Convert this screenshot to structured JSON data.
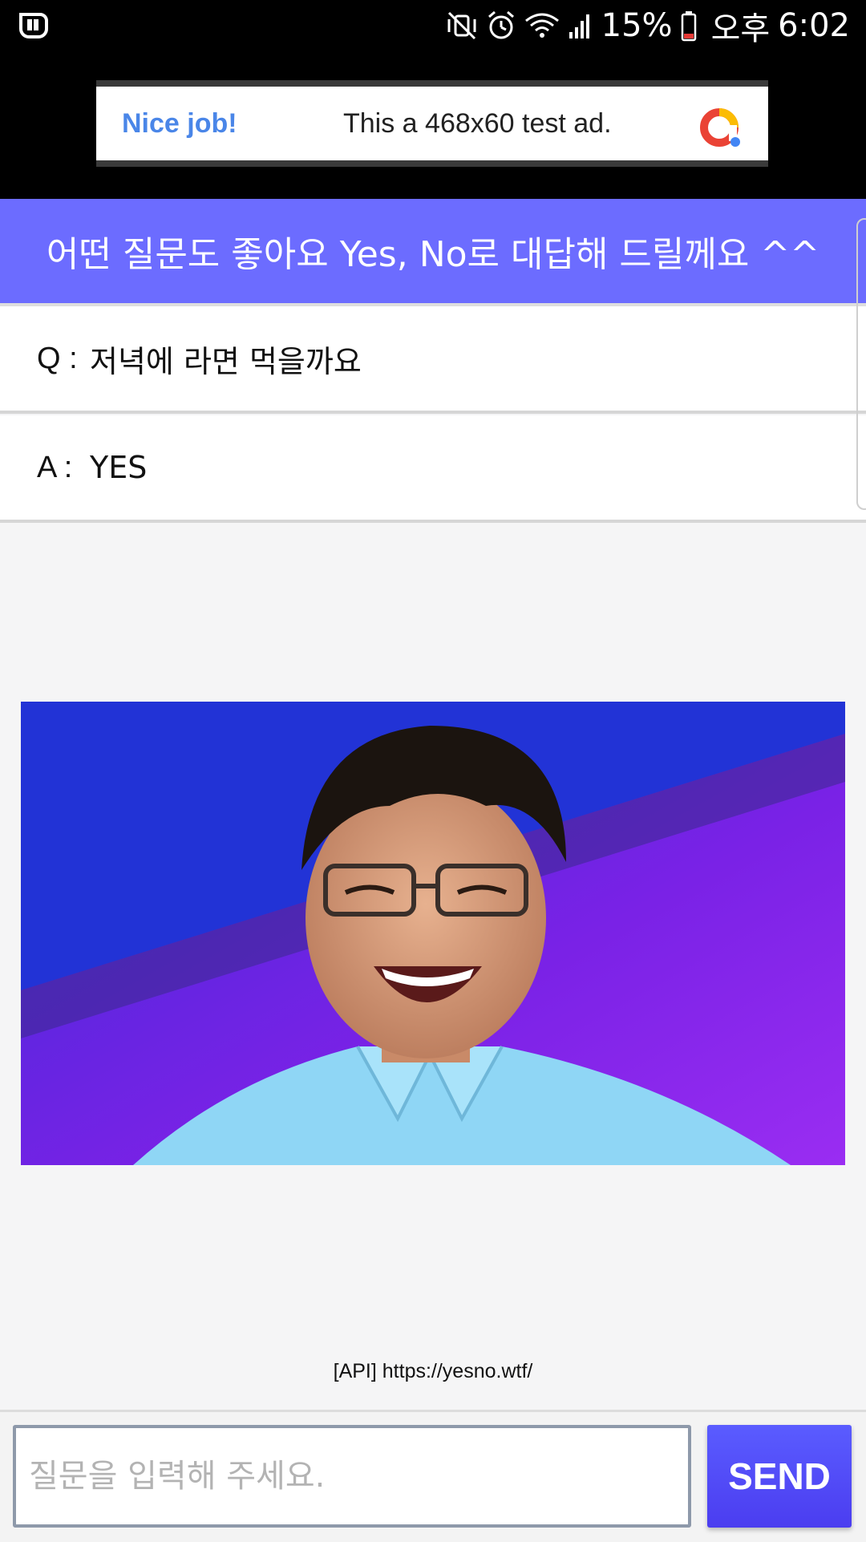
{
  "status_bar": {
    "battery": "15%",
    "ampm": "오후",
    "time": "6:02",
    "left_icon": "app-notification-icon",
    "icons": [
      "mute-vibrate-icon",
      "alarm-icon",
      "wifi-icon",
      "signal-icon",
      "battery-icon"
    ]
  },
  "ad": {
    "headline": "Nice job!",
    "body": "This a 468x60 test ad.",
    "logo_icon": "adsense-logo-icon"
  },
  "header": {
    "title": "어떤 질문도 좋아요 Yes, No로 대답해 드릴께요 ^^"
  },
  "qa": {
    "question_prefix": "Q :",
    "question": "저녁에 라면 먹을까요",
    "answer_prefix": "A :",
    "answer": "YES"
  },
  "api_link": "[API] https://yesno.wtf/",
  "input": {
    "value": "",
    "placeholder": "질문을 입력해 주세요."
  },
  "send_label": "SEND",
  "colors": {
    "header_bg": "#6c6cff",
    "ad_accent": "#4a86e8",
    "send_bg": "#5a5cff"
  }
}
